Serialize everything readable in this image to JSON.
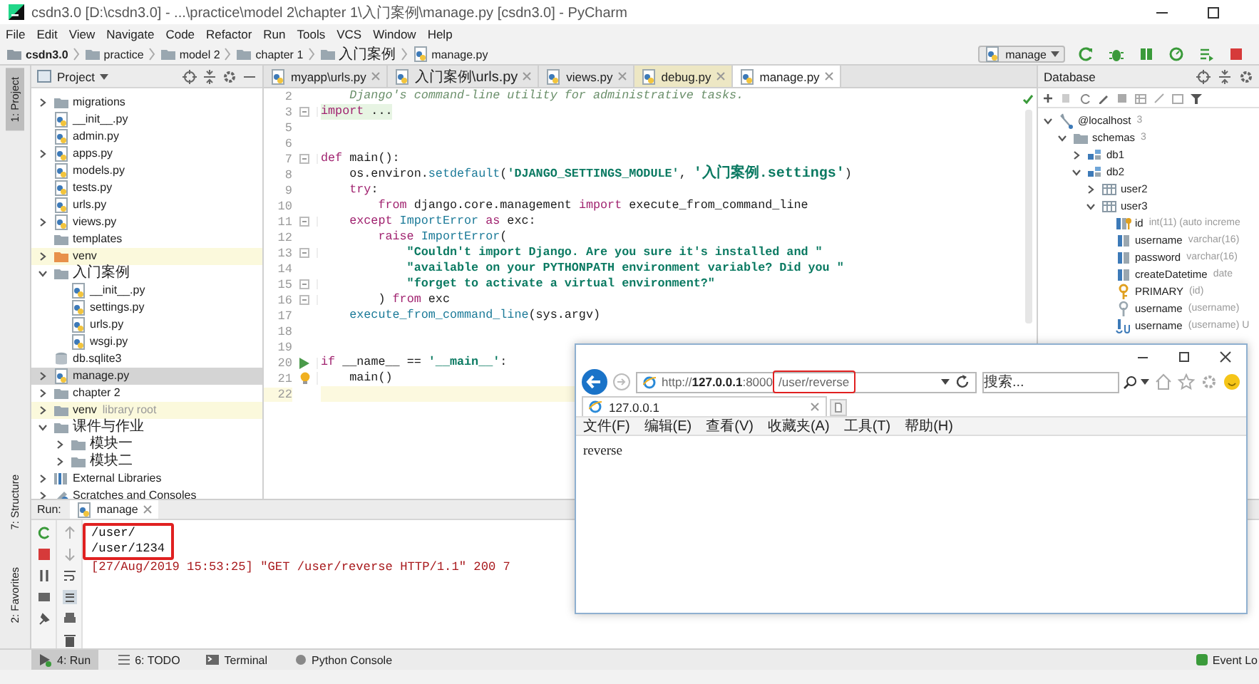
{
  "window": {
    "title": "csdn3.0 [D:\\csdn3.0] - ...\\practice\\model 2\\chapter 1\\入门案例\\manage.py [csdn3.0] - PyCharm"
  },
  "menu": [
    "File",
    "Edit",
    "View",
    "Navigate",
    "Code",
    "Refactor",
    "Run",
    "Tools",
    "VCS",
    "Window",
    "Help"
  ],
  "breadcrumbs": [
    {
      "label": "csdn3.0",
      "kind": "project"
    },
    {
      "label": "practice",
      "kind": "folder"
    },
    {
      "label": "model 2",
      "kind": "folder"
    },
    {
      "label": "chapter 1",
      "kind": "folder"
    },
    {
      "label": "入门案例",
      "kind": "folder"
    },
    {
      "label": "manage.py",
      "kind": "python"
    }
  ],
  "run_config": {
    "label": "manage"
  },
  "side_tabs": {
    "top": [
      {
        "label": "1: Project",
        "selected": true
      }
    ],
    "bottom": [
      {
        "label": "7: Structure",
        "selected": false
      },
      {
        "label": "2: Favorites",
        "selected": false
      }
    ]
  },
  "project_panel": {
    "title": "Project",
    "tree": [
      {
        "children": [
          {
            "children": [
              {
                "children": [
                  {
                    "children": [
                      {
                        "children": [
                          {
                            "children": [
                              {
                                "label": "migrations",
                                "kind": "folder",
                                "expanded": false,
                                "selected": false
                              },
                              {
                                "label": "__init__.py",
                                "kind": "python",
                                "selected": false
                              },
                              {
                                "label": "admin.py",
                                "kind": "python",
                                "selected": false
                              },
                              {
                                "label": "apps.py",
                                "kind": "python",
                                "expanded": false,
                                "selected": false
                              },
                              {
                                "label": "models.py",
                                "kind": "python",
                                "selected": false
                              },
                              {
                                "label": "tests.py",
                                "kind": "python",
                                "selected": false
                              },
                              {
                                "label": "urls.py",
                                "kind": "python",
                                "selected": false
                              },
                              {
                                "label": "views.py",
                                "kind": "python",
                                "expanded": false,
                                "selected": false
                              }
                            ]
                          },
                          {
                            "label": "templates",
                            "kind": "folder",
                            "selected": false
                          },
                          {
                            "label": "venv",
                            "kind": "excluded-folder",
                            "expanded": false,
                            "excluded": true,
                            "selected": false
                          },
                          {
                            "label": "入门案例",
                            "kind": "folder",
                            "expanded": true,
                            "selected": false,
                            "children": [
                              {
                                "label": "__init__.py",
                                "kind": "python",
                                "selected": false
                              },
                              {
                                "label": "settings.py",
                                "kind": "python",
                                "selected": false
                              },
                              {
                                "label": "urls.py",
                                "kind": "python",
                                "selected": false
                              },
                              {
                                "label": "wsgi.py",
                                "kind": "python",
                                "selected": false
                              }
                            ]
                          },
                          {
                            "label": "db.sqlite3",
                            "kind": "database",
                            "selected": false
                          },
                          {
                            "label": "manage.py",
                            "kind": "python",
                            "expanded": false,
                            "selected": true
                          }
                        ]
                      }
                    ]
                  },
                  {
                    "label": "chapter 2",
                    "kind": "folder",
                    "expanded": false,
                    "selected": false
                  }
                ]
              }
            ]
          },
          {
            "label": "venv",
            "detail": "library root",
            "kind": "folder",
            "expanded": false,
            "excluded": true,
            "selected": false
          },
          {
            "label": "课件与作业",
            "kind": "folder",
            "expanded": true,
            "selected": false,
            "children": [
              {
                "label": "模块一",
                "kind": "folder",
                "expanded": false,
                "selected": false
              },
              {
                "label": "模块二",
                "kind": "folder",
                "expanded": false,
                "selected": false
              }
            ]
          }
        ]
      },
      {
        "label": "External Libraries",
        "kind": "library",
        "expanded": false,
        "selected": false
      },
      {
        "label": "Scratches and Consoles",
        "kind": "scratches",
        "expanded": false,
        "selected": false
      }
    ]
  },
  "editor": {
    "tabs": [
      {
        "label": "myapp\\urls.py",
        "selected": false
      },
      {
        "label": "入门案例\\urls.py",
        "selected": false
      },
      {
        "label": "views.py",
        "selected": false
      },
      {
        "label": "debug.py",
        "selected": false,
        "excluded": true
      },
      {
        "label": "manage.py",
        "selected": true
      }
    ],
    "lines": [
      {
        "number": "2",
        "current": false,
        "tokens": [
          {
            "text": "    Django's command-line utility for administrative tasks.",
            "kind": "doc"
          }
        ]
      },
      {
        "number": "3",
        "current": false,
        "folded": true,
        "kind": "fold",
        "tokens": [
          {
            "text": "import",
            "kind": "keyword"
          },
          {
            "text": " ...",
            "kind": "plain"
          }
        ]
      },
      {
        "number": "5",
        "current": false
      },
      {
        "number": "6",
        "current": false
      },
      {
        "number": "7",
        "current": false,
        "kind": "fold",
        "tokens": [
          {
            "text": "def",
            "kind": "keyword"
          },
          {
            "text": " main():",
            "kind": "plain"
          }
        ]
      },
      {
        "number": "8",
        "current": false,
        "tokens": [
          {
            "text": "    os.environ.",
            "kind": "plain"
          },
          {
            "text": "setdefault",
            "kind": "call"
          },
          {
            "text": "(",
            "kind": "plain"
          },
          {
            "text": "'DJANGO_SETTINGS_MODULE'",
            "kind": "string"
          },
          {
            "text": ", ",
            "kind": "plain"
          },
          {
            "text": "'入门案例.settings'",
            "kind": "string"
          },
          {
            "text": ")",
            "kind": "plain"
          }
        ]
      },
      {
        "number": "9",
        "current": false,
        "tokens": [
          {
            "text": "    try",
            "kind": "keyword"
          },
          {
            "text": ":",
            "kind": "plain"
          }
        ]
      },
      {
        "number": "10",
        "current": false,
        "tokens": [
          {
            "text": "        from",
            "kind": "keyword"
          },
          {
            "text": " django.core.management ",
            "kind": "plain"
          },
          {
            "text": "import",
            "kind": "keyword"
          },
          {
            "text": " execute_from_command_line",
            "kind": "plain"
          }
        ]
      },
      {
        "number": "11",
        "current": false,
        "kind": "fold",
        "tokens": [
          {
            "text": "    except",
            "kind": "keyword"
          },
          {
            "text": " ImportError",
            "kind": "class"
          },
          {
            "text": " as",
            "kind": "keyword"
          },
          {
            "text": " exc:",
            "kind": "plain"
          }
        ]
      },
      {
        "number": "12",
        "current": false,
        "tokens": [
          {
            "text": "        raise",
            "kind": "keyword"
          },
          {
            "text": " ImportError",
            "kind": "class"
          },
          {
            "text": "(",
            "kind": "plain"
          }
        ]
      },
      {
        "number": "13",
        "current": false,
        "kind": "fold",
        "tokens": [
          {
            "text": "            \"Couldn't import Django. Are you sure it's installed and \"",
            "kind": "string"
          }
        ]
      },
      {
        "number": "14",
        "current": false,
        "tokens": [
          {
            "text": "            \"available on your PYTHONPATH environment variable? Did you \"",
            "kind": "string"
          }
        ]
      },
      {
        "number": "15",
        "current": false,
        "kind": "fold",
        "tokens": [
          {
            "text": "            \"forget to activate a virtual environment?\"",
            "kind": "string"
          }
        ]
      },
      {
        "number": "16",
        "current": false,
        "kind": "fold",
        "tokens": [
          {
            "text": "        ) ",
            "kind": "plain"
          },
          {
            "text": "from",
            "kind": "keyword"
          },
          {
            "text": " exc",
            "kind": "plain"
          }
        ]
      },
      {
        "number": "17",
        "current": false,
        "tokens": [
          {
            "text": "    execute_from_command_line",
            "kind": "call"
          },
          {
            "text": "(sys.argv)",
            "kind": "plain"
          }
        ]
      },
      {
        "number": "18",
        "current": false
      },
      {
        "number": "19",
        "current": false
      },
      {
        "number": "20",
        "current": false,
        "kind": "run",
        "tokens": [
          {
            "text": "if",
            "kind": "keyword"
          },
          {
            "text": " __name__ == ",
            "kind": "plain"
          },
          {
            "text": "'__main__'",
            "kind": "string"
          },
          {
            "text": ":",
            "kind": "plain"
          }
        ]
      },
      {
        "number": "21",
        "current": false,
        "kind": "bulb",
        "tokens": [
          {
            "text": "    main()",
            "kind": "plain"
          }
        ]
      },
      {
        "number": "22",
        "current": true
      }
    ]
  },
  "database": {
    "title": "Database",
    "tree": [
      {
        "label": "@localhost",
        "detail": "3",
        "kind": "host",
        "expanded": true,
        "children": [
          {
            "label": "schemas",
            "detail": "3",
            "kind": "folder",
            "expanded": true,
            "children": [
              {
                "label": "db1",
                "kind": "schema",
                "expanded": false
              },
              {
                "label": "db2",
                "kind": "schema",
                "expanded": true,
                "children": [
                  {
                    "label": "user2",
                    "kind": "table",
                    "expanded": false
                  },
                  {
                    "label": "user3",
                    "kind": "table",
                    "expanded": true,
                    "children": [
                      {
                        "label": "id",
                        "detail": "int(11) (auto increme",
                        "kind": "key-column"
                      },
                      {
                        "label": "username",
                        "detail": "varchar(16)",
                        "kind": "column"
                      },
                      {
                        "label": "password",
                        "detail": "varchar(16)",
                        "kind": "column"
                      },
                      {
                        "label": "createDatetime",
                        "detail": "date",
                        "kind": "column"
                      },
                      {
                        "label": "PRIMARY",
                        "detail": "(id)",
                        "kind": "primary-key"
                      },
                      {
                        "label": "username",
                        "detail": "(username)",
                        "kind": "index"
                      },
                      {
                        "label": "username",
                        "detail": "(username) U",
                        "kind": "unique-index"
                      }
                    ]
                  }
                ]
              }
            ]
          }
        ]
      }
    ]
  },
  "run": {
    "label": "Run:",
    "tab": "manage",
    "output": [
      {
        "text": "/user/",
        "kind": "stdout",
        "boxed": true
      },
      {
        "text": "/user/1234",
        "kind": "stdout",
        "boxed": true
      },
      {
        "text": "[27/Aug/2019 15:53:25] \"GET /user/reverse HTTP/1.1\" 200 7",
        "kind": "stderr",
        "boxed": false
      }
    ]
  },
  "bottom_bar": {
    "tools": [
      {
        "label": "4: Run",
        "kind": "run",
        "selected": true
      },
      {
        "label": "6: TODO",
        "kind": "todo",
        "selected": false
      },
      {
        "label": "Terminal",
        "kind": "terminal",
        "selected": false
      },
      {
        "label": "Python Console",
        "kind": "console",
        "selected": false
      }
    ],
    "event_log": "Event Lo"
  },
  "browser": {
    "url_host": "http://**127.0.0.1**:8000",
    "url_path": {
      "text": "/user/reverse",
      "boxed": true
    },
    "search": {
      "placeholder": "搜索..."
    },
    "tab": "127.0.0.1",
    "menu": [
      "文件(F)",
      "编辑(E)",
      "查看(V)",
      "收藏夹(A)",
      "工具(T)",
      "帮助(H)"
    ],
    "body": "reverse"
  }
}
